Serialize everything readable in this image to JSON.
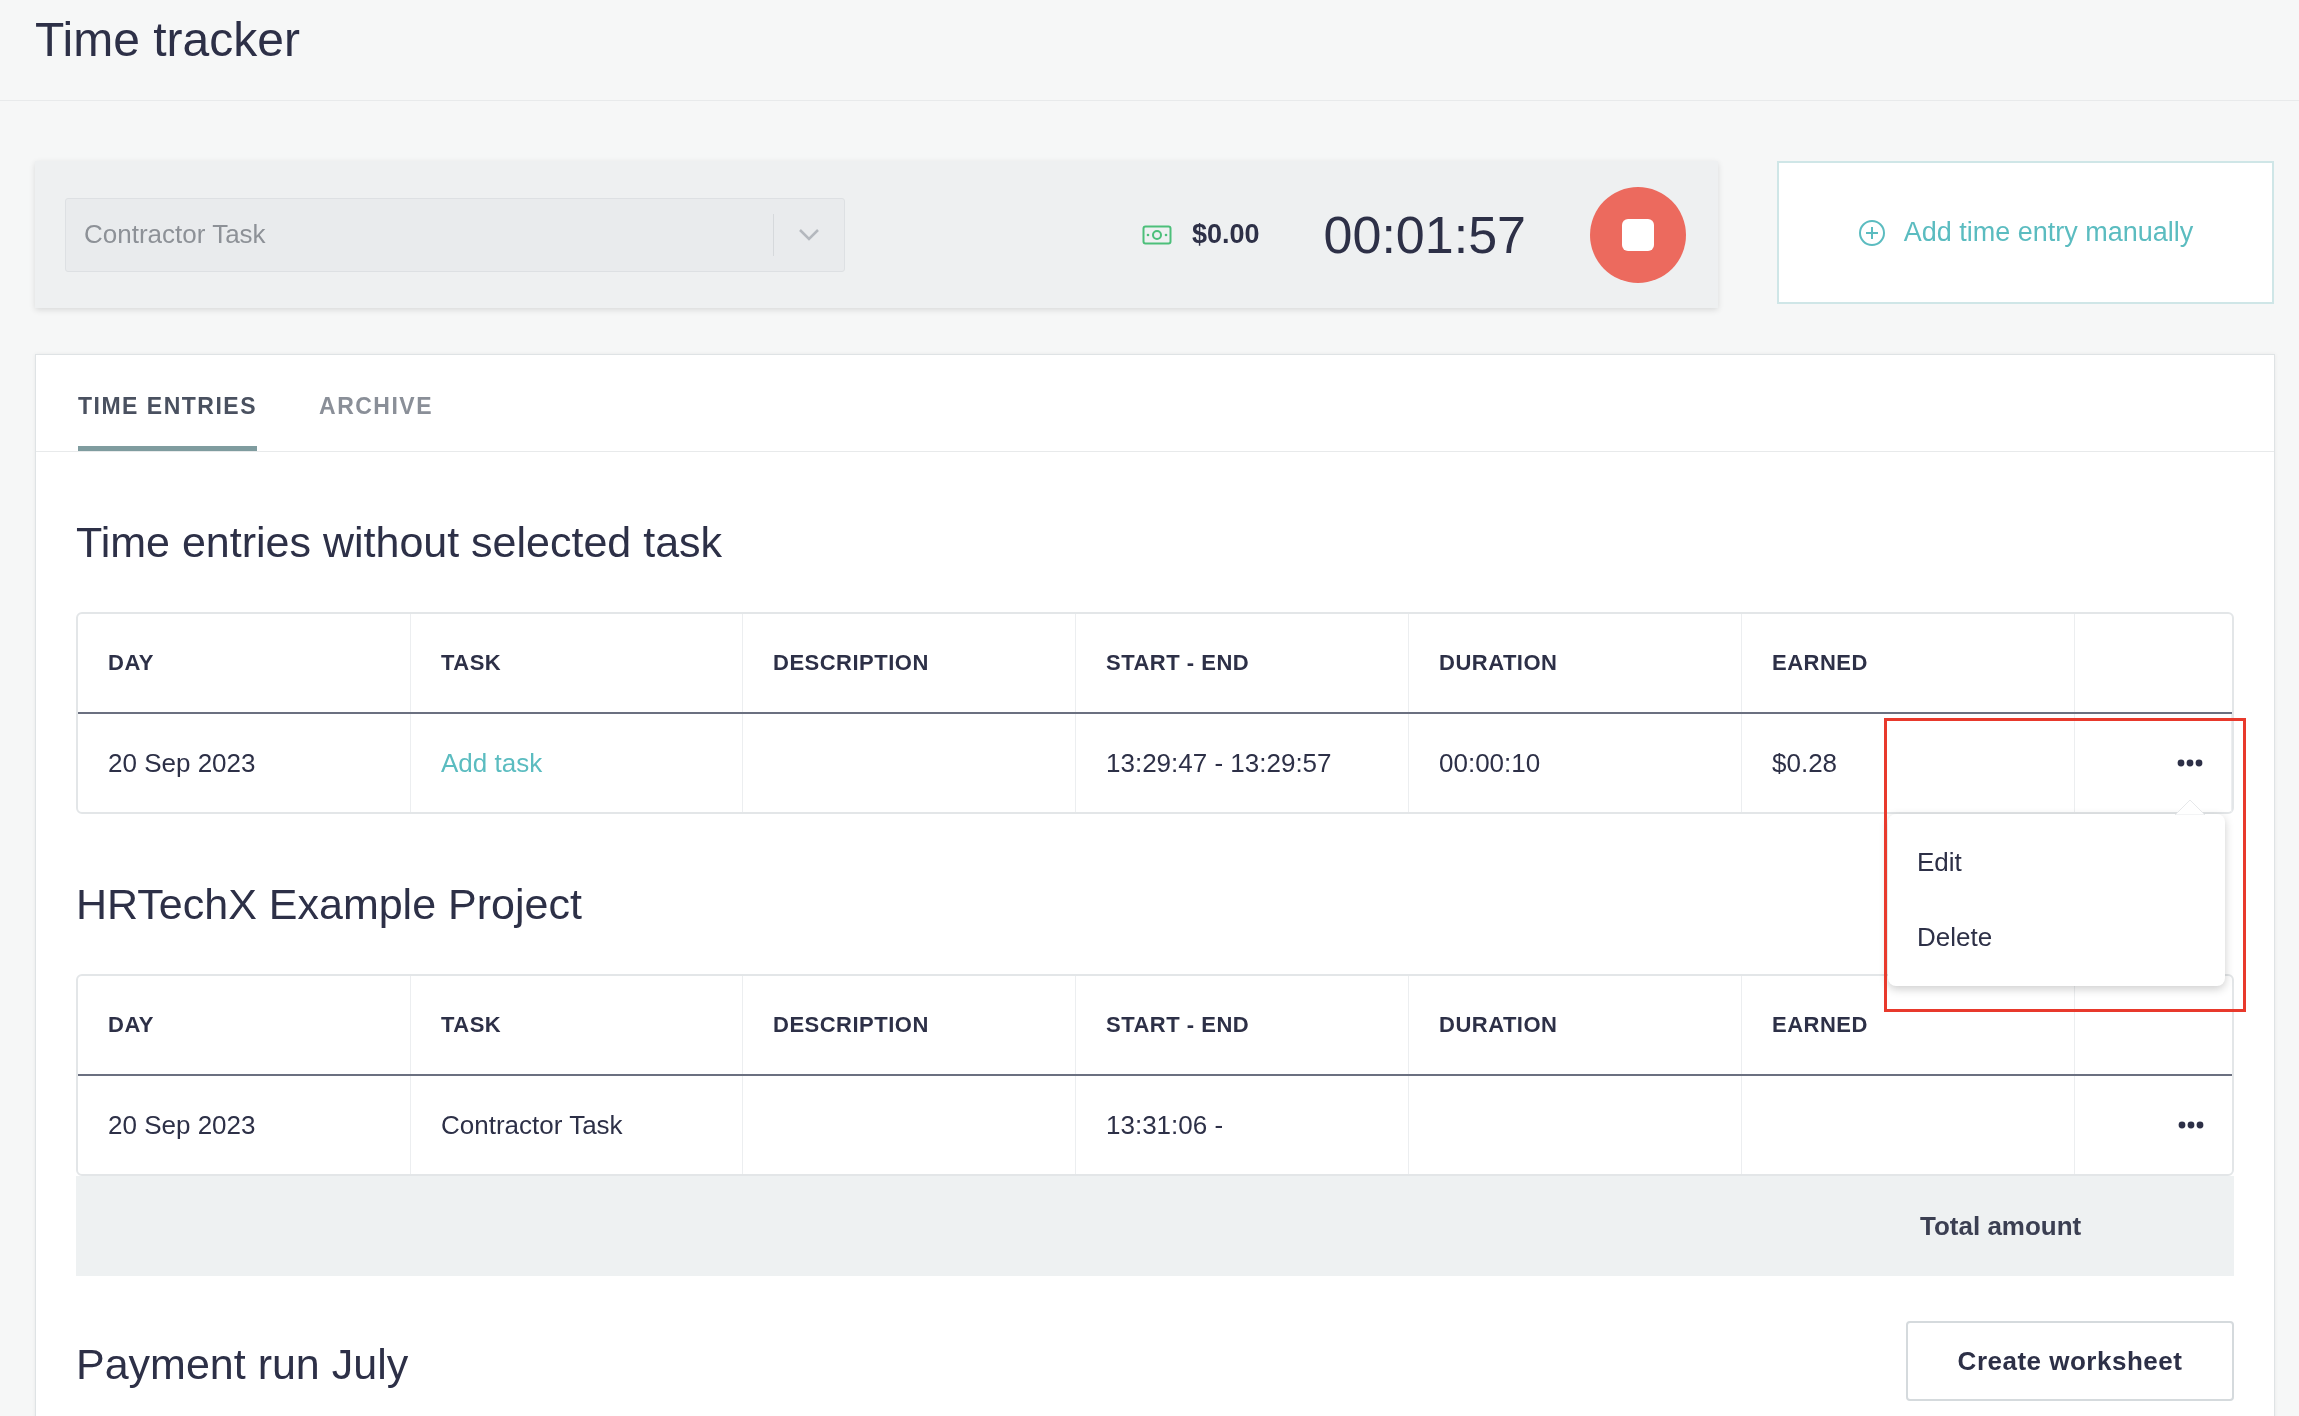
{
  "page": {
    "title": "Time tracker"
  },
  "timer": {
    "task_select": {
      "value": "Contractor Task"
    },
    "earned": "$0.00",
    "elapsed": "00:01:57",
    "running": true
  },
  "add_entry_button": {
    "label": "Add time entry manually"
  },
  "tabs": [
    {
      "label": "TIME ENTRIES",
      "selected": true
    },
    {
      "label": "ARCHIVE",
      "selected": false
    }
  ],
  "sections": [
    {
      "title": "Time entries without selected task",
      "columns": [
        "DAY",
        "TASK",
        "DESCRIPTION",
        "START - END",
        "DURATION",
        "EARNED"
      ],
      "rows": [
        {
          "day": "20 Sep 2023",
          "task": {
            "text": "Add task",
            "kind": "link"
          },
          "start_end": "13:29:47 - 13:29:57",
          "duration": "00:00:10",
          "earned": "$0.28",
          "menu_open": true
        }
      ]
    },
    {
      "title": "HRTechX Example Project",
      "columns": [
        "DAY",
        "TASK",
        "DESCRIPTION",
        "START - END",
        "DURATION",
        "EARNED"
      ],
      "rows": [
        {
          "day": "20 Sep 2023",
          "task": {
            "text": "Contractor Task",
            "kind": "text"
          },
          "start_end": "13:31:06 -",
          "menu_open": false
        }
      ],
      "footer": "Total amount"
    }
  ],
  "row_menu": {
    "items": [
      "Edit",
      "Delete"
    ],
    "highlighted": true
  },
  "payment_run": {
    "title": "Payment run July",
    "button": "Create worksheet"
  }
}
